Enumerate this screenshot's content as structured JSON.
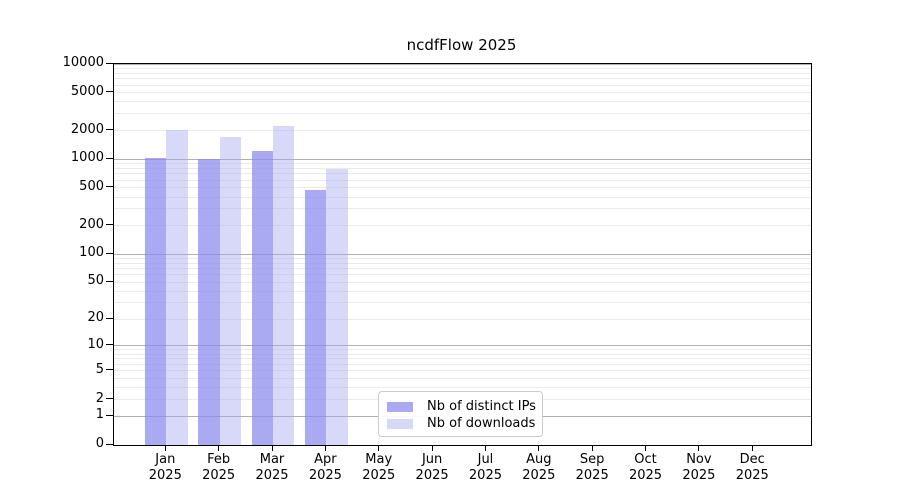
{
  "figure": {
    "background": "#ffffff",
    "spine_color": "#000000"
  },
  "chart_data": {
    "type": "bar",
    "title": "ncdfFlow 2025",
    "categories": [
      "Jan 2025",
      "Feb 2025",
      "Mar 2025",
      "Apr 2025",
      "May 2025",
      "Jun 2025",
      "Jul 2025",
      "Aug 2025",
      "Sep 2025",
      "Oct 2025",
      "Nov 2025",
      "Dec 2025"
    ],
    "series": [
      {
        "name": "Nb of distinct IPs",
        "color": "rgba(137,137,238,0.72)",
        "values": [
          1040,
          1005,
          1220,
          475,
          null,
          null,
          null,
          null,
          null,
          null,
          null,
          null
        ]
      },
      {
        "name": "Nb of downloads",
        "color": "rgba(165,165,240,0.43)",
        "values": [
          2010,
          1725,
          2250,
          785,
          null,
          null,
          null,
          null,
          null,
          null,
          null,
          null
        ]
      }
    ],
    "yscale": "log10(value+1)",
    "ylim": [
      0,
      10000
    ],
    "yticks": [
      10000,
      5000,
      2000,
      1000,
      500,
      200,
      100,
      50,
      20,
      10,
      5,
      2,
      1,
      0
    ],
    "xlabel": "",
    "ylabel": "",
    "grid": {
      "show": true,
      "major_color": "#b0b0b0",
      "minor_color": "#ebebeb"
    },
    "legend": {
      "position": "inside-bottom-center",
      "border_color": "#cccccc",
      "background": "rgba(255,255,255,0.92)"
    }
  }
}
